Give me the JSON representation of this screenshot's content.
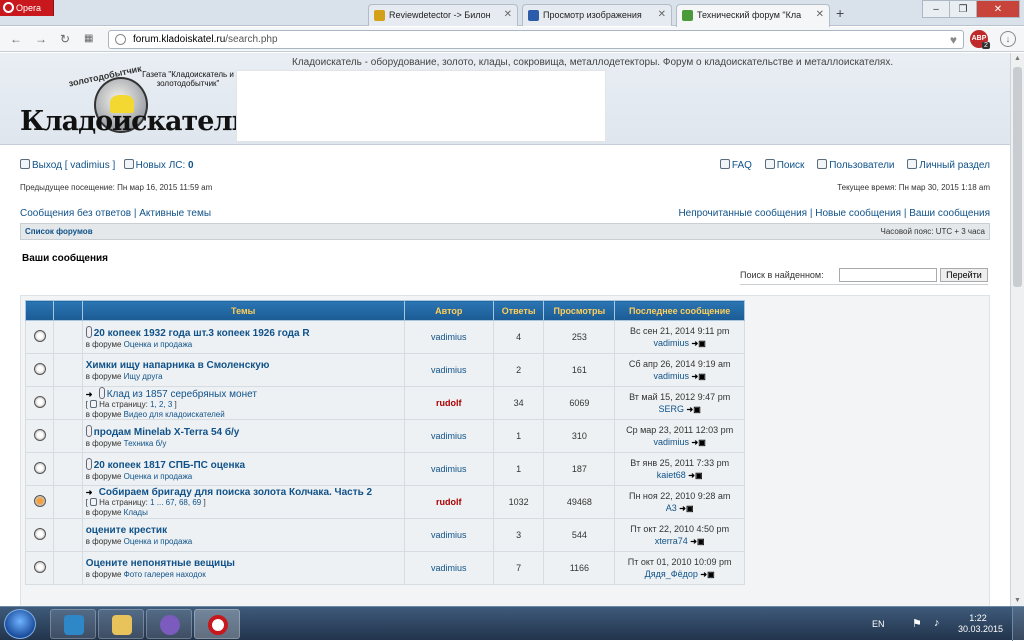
{
  "browser": {
    "menu_label": "Opera",
    "tabs": [
      {
        "title": "Reviewdetector -> Билон",
        "active": false,
        "favicon_color": "#d4a017"
      },
      {
        "title": "Просмотр изображения",
        "active": false,
        "favicon_color": "#2a5caa"
      },
      {
        "title": "Технический форум \"Кла",
        "active": true,
        "favicon_color": "#4a9a3a"
      }
    ],
    "new_tab": "+",
    "address": {
      "host": "forum.kladoiskatel.ru",
      "path": "/search.php"
    },
    "abp_label": "ABP",
    "abp_badge": "2"
  },
  "site": {
    "description": "Кладоискатель - оборудование, золото, клады, сокровища, металлодетекторы. Форум о кладоискательстве и металлоискателях.",
    "logo": {
      "brand": "Кладоискатель",
      "arc_text": "золотодобытчик",
      "caption": "Газета \"Кладоискатель и золотодобытчик\""
    }
  },
  "userbar": {
    "logout": "Выход",
    "username": "vadimius",
    "new_pm_label": "Новых ЛС:",
    "new_pm_count": "0",
    "faq": "FAQ",
    "search": "Поиск",
    "users": "Пользователи",
    "ucp": "Личный раздел"
  },
  "visits": {
    "last_visit": "Предыдущее посещение: Пн мар 16, 2015 11:59 am",
    "current_time": "Текущее время: Пн мар 30, 2015 1:18 am"
  },
  "quicklinks": {
    "unanswered": "Сообщения без ответов",
    "active": "Активные темы",
    "unread": "Непрочитанные сообщения",
    "new_posts": "Новые сообщения",
    "own_posts": "Ваши сообщения"
  },
  "breadcrumb": {
    "index": "Список форумов",
    "timezone": "Часовой пояс: UTC + 3 часа"
  },
  "page": {
    "heading": "Ваши сообщения",
    "search_found_label": "Поиск в найденном:",
    "search_found_value": "",
    "go_button": "Перейти"
  },
  "table": {
    "headers": {
      "topics": "Темы",
      "author": "Автор",
      "replies": "Ответы",
      "views": "Просмотры",
      "last_post": "Последнее сообщение"
    },
    "in_forum": "в форуме",
    "on_page": "На страницу:",
    "rows": [
      {
        "title": "20 копеек 1932 года шт.3 копеек 1926 года R",
        "forum": "Оценка и продажа",
        "author": "vadimius",
        "author_red": false,
        "replies": "4",
        "views": "253",
        "last_date": "Вс сен 21, 2014 9:11 pm",
        "last_user": "vadimius",
        "attachment": true,
        "new": false,
        "hot": false,
        "pages": "",
        "bold": true
      },
      {
        "title": "Химки ищу напарника в Смоленскую",
        "forum": "Ищу друга",
        "author": "vadimius",
        "author_red": false,
        "replies": "2",
        "views": "161",
        "last_date": "Сб апр 26, 2014 9:19 am",
        "last_user": "vadimius",
        "attachment": false,
        "new": false,
        "hot": false,
        "pages": "",
        "bold": true
      },
      {
        "title": "Клад из 1857 серебряных монет",
        "forum": "Видео для кладоискателей",
        "author": "rudolf",
        "author_red": true,
        "replies": "34",
        "views": "6069",
        "last_date": "Вт май 15, 2012 9:47 pm",
        "last_user": "SERG",
        "attachment": true,
        "new": true,
        "hot": false,
        "pages": "1, 2, 3",
        "bold": false
      },
      {
        "title": "продам Minelab X-Terra 54 б/у",
        "forum": "Техника б/у",
        "author": "vadimius",
        "author_red": false,
        "replies": "1",
        "views": "310",
        "last_date": "Ср мар 23, 2011 12:03 pm",
        "last_user": "vadimius",
        "attachment": true,
        "new": false,
        "hot": false,
        "pages": "",
        "bold": true
      },
      {
        "title": "20 копеек 1817 СПБ-ПС оценка",
        "forum": "Оценка и продажа",
        "author": "vadimius",
        "author_red": false,
        "replies": "1",
        "views": "187",
        "last_date": "Вт янв 25, 2011 7:33 pm",
        "last_user": "kaiet68",
        "attachment": true,
        "new": false,
        "hot": false,
        "pages": "",
        "bold": true
      },
      {
        "title": "Собираем бригаду для поиска золота Колчака. Часть 2",
        "forum": "Клады",
        "author": "rudolf",
        "author_red": true,
        "replies": "1032",
        "views": "49468",
        "last_date": "Пн ноя 22, 2010 9:28 am",
        "last_user": "A3",
        "attachment": false,
        "new": true,
        "hot": true,
        "pages": "1 ... 67, 68, 69",
        "bold": true
      },
      {
        "title": "оцените крестик",
        "forum": "Оценка и продажа",
        "author": "vadimius",
        "author_red": false,
        "replies": "3",
        "views": "544",
        "last_date": "Пт окт 22, 2010 4:50 pm",
        "last_user": "xterra74",
        "attachment": false,
        "new": false,
        "hot": false,
        "pages": "",
        "bold": true
      },
      {
        "title": "Оцените непонятные вещицы",
        "forum": "Фото галерея находок",
        "author": "vadimius",
        "author_red": false,
        "replies": "7",
        "views": "1166",
        "last_date": "Пт окт 01, 2010 10:09 pm",
        "last_user": "Дядя_Фёдор",
        "attachment": false,
        "new": false,
        "hot": false,
        "pages": "",
        "bold": true
      }
    ]
  },
  "taskbar": {
    "lang": "EN",
    "time": "1:22",
    "date": "30.03.2015"
  }
}
